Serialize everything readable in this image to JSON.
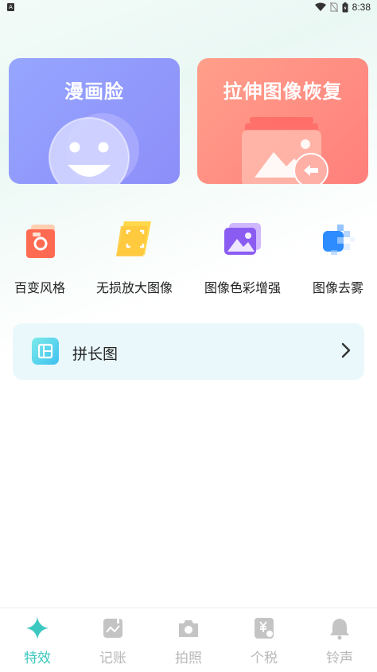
{
  "status_bar": {
    "app_indicator": "A",
    "time": "8:38"
  },
  "feature_cards": [
    {
      "title": "漫画脸"
    },
    {
      "title": "拉伸图像恢复"
    }
  ],
  "tools": [
    {
      "label": "百变风格"
    },
    {
      "label": "无损放大图像"
    },
    {
      "label": "图像色彩增强"
    },
    {
      "label": "图像去雾"
    }
  ],
  "long_image": {
    "label": "拼长图"
  },
  "tabbar": {
    "active_index": 0,
    "active_color": "#3cc8c0",
    "inactive_color": "#b8b8b8",
    "items": [
      {
        "label": "特效"
      },
      {
        "label": "记账"
      },
      {
        "label": "拍照"
      },
      {
        "label": "个税"
      },
      {
        "label": "铃声"
      }
    ]
  }
}
